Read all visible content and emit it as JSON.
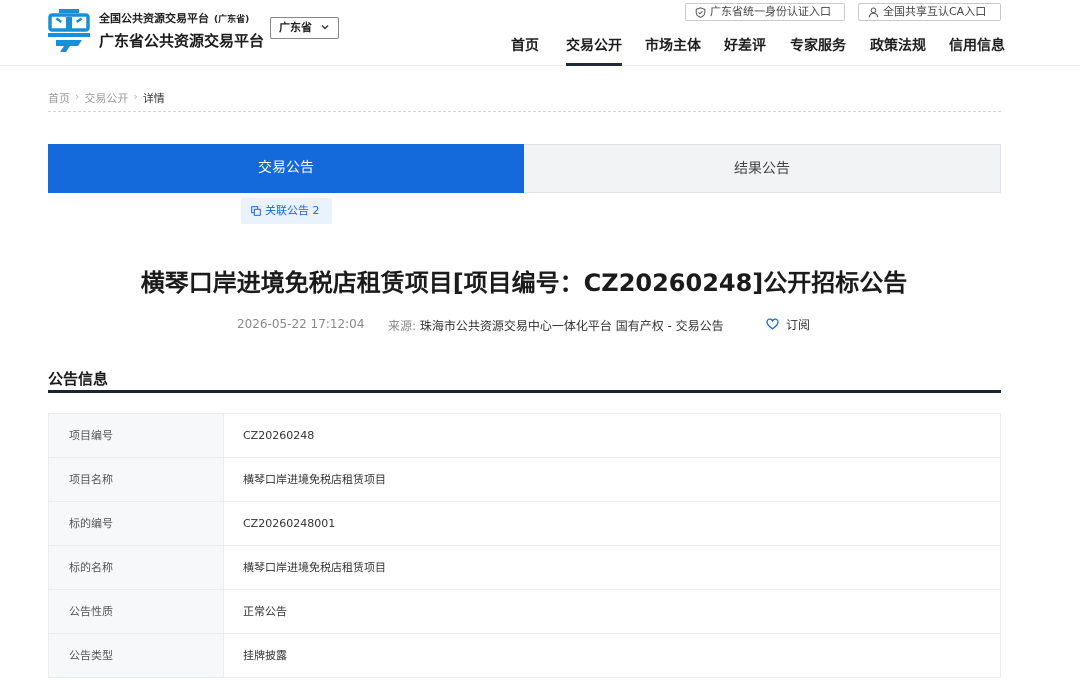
{
  "header": {
    "platform_national": "全国公共资源交易平台",
    "platform_region_tag": "(广东省)",
    "platform_name": "广东省公共资源交易平台",
    "region_select": "广东省",
    "auth_links": [
      "广东省统一身份认证入口",
      "全国共享互认CA入口"
    ],
    "nav": [
      "首页",
      "交易公开",
      "市场主体",
      "好差评",
      "专家服务",
      "政策法规",
      "信用信息"
    ],
    "nav_active": "交易公开"
  },
  "breadcrumb": [
    "首页",
    "交易公开",
    "详情"
  ],
  "tabs": [
    "交易公告",
    "结果公告"
  ],
  "related_notice": "关联公告 2",
  "notice": {
    "title": "横琴口岸进境免税店租赁项目[项目编号：CZ20260248]公开招标公告",
    "date": "2026-05-22 17:12:04",
    "source_label": "来源:",
    "source": "珠海市公共资源交易中心一体化平台 国有产权 - 交易公告",
    "subscribe": "订阅"
  },
  "info_section": {
    "title": "公告信息",
    "rows": [
      {
        "label": "项目编号",
        "value": "CZ20260248"
      },
      {
        "label": "项目名称",
        "value": "横琴口岸进境免税店租赁项目"
      },
      {
        "label": "标的编号",
        "value": "CZ20260248001"
      },
      {
        "label": "标的名称",
        "value": "横琴口岸进境免税店租赁项目"
      },
      {
        "label": "公告性质",
        "value": "正常公告"
      },
      {
        "label": "公告类型",
        "value": "挂牌披露"
      }
    ]
  },
  "colors": {
    "accent": "#1469db",
    "logo": "#1b8fd6",
    "nav_underline": "#1f2a3a"
  }
}
